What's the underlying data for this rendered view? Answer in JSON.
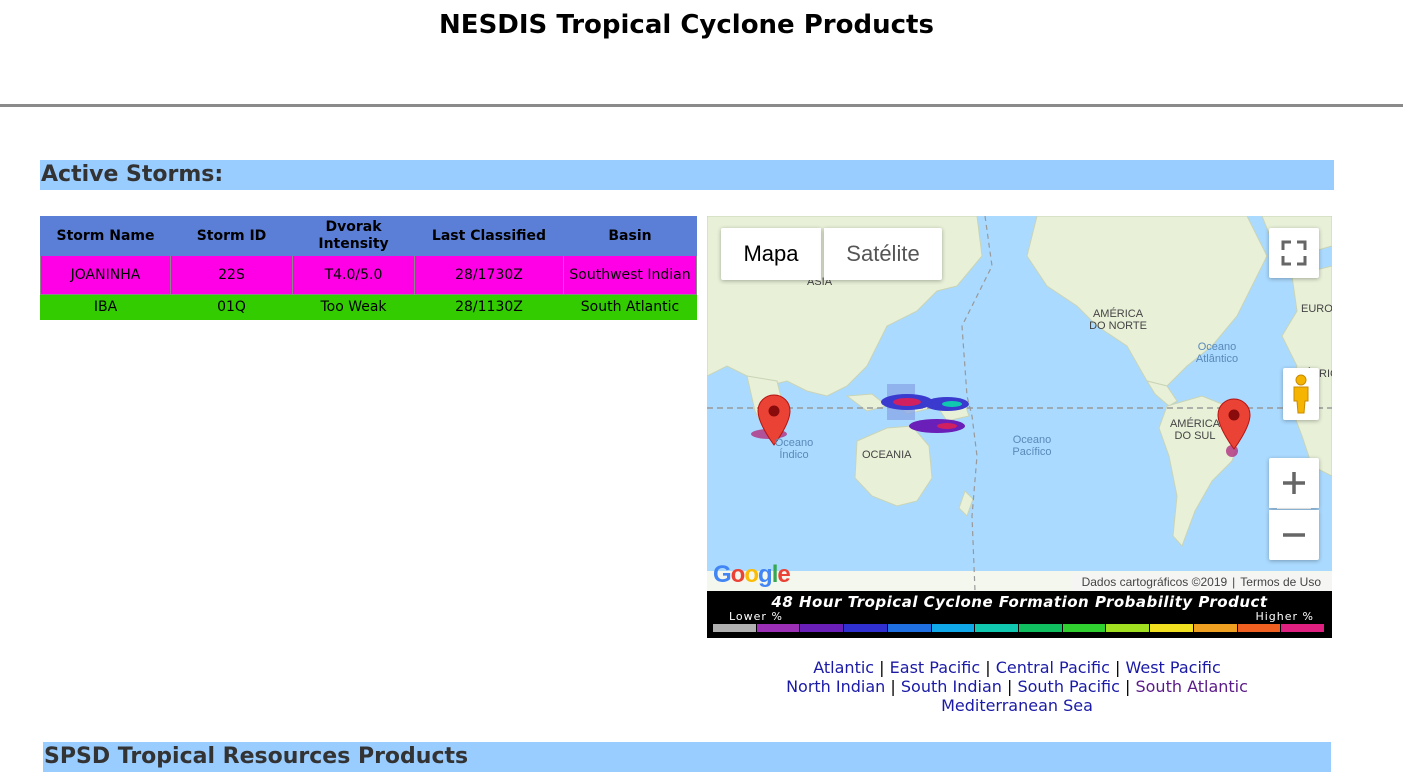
{
  "page": {
    "title": "NESDIS Tropical Cyclone Products"
  },
  "active_section": {
    "title": "Active Storms:"
  },
  "next_section": {
    "title": "SPSD Tropical Resources Products"
  },
  "storm_table": {
    "headers": [
      "Storm Name",
      "Storm ID",
      "Dvorak Intensity",
      "Last Classified",
      "Basin"
    ],
    "rows": [
      {
        "name": "JOANINHA",
        "id": "22S",
        "intensity": "T4.0/5.0",
        "classified": "28/1730Z",
        "basin": "Southwest Indian",
        "color": "#ff00e6"
      },
      {
        "name": "IBA",
        "id": "01Q",
        "intensity": "Too Weak",
        "classified": "28/1130Z",
        "basin": "South Atlantic",
        "color": "#33cc00"
      }
    ]
  },
  "map": {
    "map_button": "Mapa",
    "satellite_button": "Satélite",
    "attribution": "Dados cartográficos ©2019",
    "terms": "Termos de Uso",
    "logo": "Google",
    "labels": {
      "asia": "ÁSIA",
      "north_america": "AMÉRICA DO NORTE",
      "europe": "EURO",
      "atlantic_ocean": "Oceano Atlântico",
      "indian_ocean": "Oceano Índico",
      "oceania": "OCEANIA",
      "pacific_ocean": "Oceano Pacífico",
      "south_america": "AMÉRICA DO SUL",
      "afric": "ÁFRIC"
    },
    "icons": [
      "fullscreen-icon",
      "pegman-icon",
      "zoom-in-icon",
      "zoom-out-icon",
      "map-marker-icon"
    ]
  },
  "legend": {
    "title": "48 Hour Tropical Cyclone Formation Probability Product",
    "lower": "Lower %",
    "higher": "Higher %",
    "colors": [
      "#b0b0b0",
      "#9b2fb5",
      "#6a1fb8",
      "#3030d0",
      "#1f6fe0",
      "#10a8e8",
      "#10c8b0",
      "#10c060",
      "#30d030",
      "#a0e020",
      "#f0e020",
      "#f0a020",
      "#f06020",
      "#e02080"
    ]
  },
  "basin_links": [
    {
      "label": "Atlantic",
      "visited": false
    },
    {
      "label": "East Pacific",
      "visited": false
    },
    {
      "label": "Central Pacific",
      "visited": false
    },
    {
      "label": "West Pacific",
      "visited": false
    },
    {
      "label": "North Indian",
      "visited": false
    },
    {
      "label": "South Indian",
      "visited": false
    },
    {
      "label": "South Pacific",
      "visited": false
    },
    {
      "label": "South Atlantic",
      "visited": true
    },
    {
      "label": "Mediterranean Sea",
      "visited": false
    }
  ]
}
